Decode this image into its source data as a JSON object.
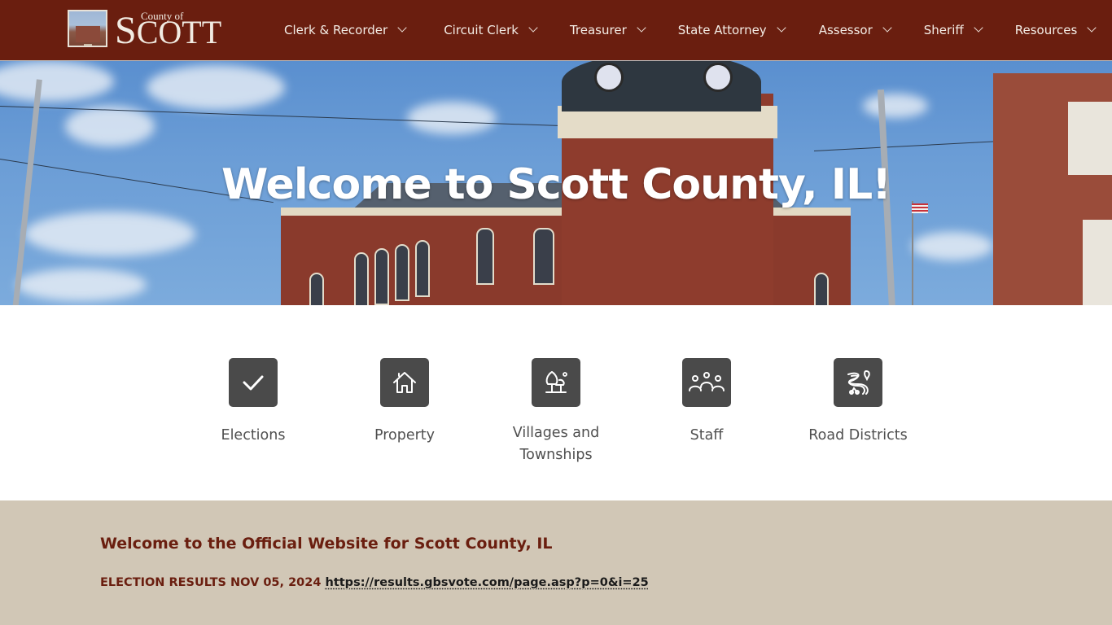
{
  "header": {
    "logo": {
      "county_of": "County of",
      "name_initial": "S",
      "name_rest": "COTT"
    },
    "nav": [
      {
        "label": "Clerk & Recorder",
        "icon": "chevron-down-icon"
      },
      {
        "label": "Circuit Clerk",
        "icon": "chevron-down-icon"
      },
      {
        "label": "Treasurer",
        "icon": "chevron-down-icon"
      },
      {
        "label": "State Attorney",
        "icon": "chevron-down-icon"
      },
      {
        "label": "Assessor",
        "icon": "chevron-down-icon"
      },
      {
        "label": "Sheriff",
        "icon": "chevron-down-icon"
      },
      {
        "label": "Resources",
        "icon": "chevron-down-icon"
      }
    ]
  },
  "hero": {
    "title": "Welcome to Scott County, IL!"
  },
  "quick_links": [
    {
      "label": "Elections",
      "icon": "checkmark-icon"
    },
    {
      "label": "Property",
      "icon": "house-icon"
    },
    {
      "label": "Villages and Townships",
      "icon": "trees-icon"
    },
    {
      "label": "Staff",
      "icon": "people-group-icon"
    },
    {
      "label": "Road Districts",
      "icon": "winding-road-icon"
    }
  ],
  "intro": {
    "heading": "Welcome to the Official Website for Scott County, IL",
    "election_label": "ELECTION RESULTS NOV 05, 2024",
    "election_link": "https://results.gbsvote.com/page.asp?p=0&i=25"
  },
  "colors": {
    "header_bg": "#6a1e0f",
    "icon_tile": "#4a4a4a",
    "intro_bg": "#d1c7b6",
    "heading_text": "#6a1e0f"
  }
}
